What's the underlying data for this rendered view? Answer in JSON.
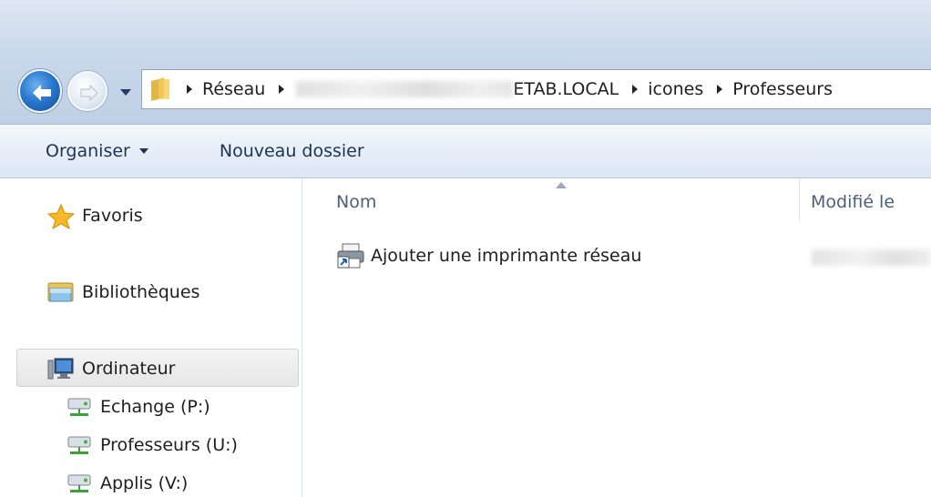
{
  "address": {
    "crumbs": [
      "Réseau",
      "ETAB.LOCAL",
      "icones",
      "Professeurs"
    ]
  },
  "toolbar": {
    "organise_label": "Organiser",
    "new_folder_label": "Nouveau dossier"
  },
  "navigation": {
    "favorites": "Favoris",
    "libraries": "Bibliothèques",
    "computer": "Ordinateur",
    "drives": [
      "Echange (P:)",
      "Professeurs (U:)",
      "Applis (V:)"
    ]
  },
  "content": {
    "columns": {
      "name": "Nom",
      "modified": "Modifié le"
    },
    "items": [
      {
        "name": "Ajouter une imprimante réseau"
      }
    ]
  },
  "icons": {
    "back": "back-arrow-icon",
    "forward": "forward-arrow-icon",
    "favorites": "star-icon",
    "libraries": "library-icon",
    "computer": "computer-icon",
    "drive": "network-drive-icon",
    "item": "printer-shortcut-icon"
  },
  "colors": {
    "accent": "#2a78cf",
    "toolbar_text": "#1e3252",
    "header_text": "#4c607a"
  }
}
